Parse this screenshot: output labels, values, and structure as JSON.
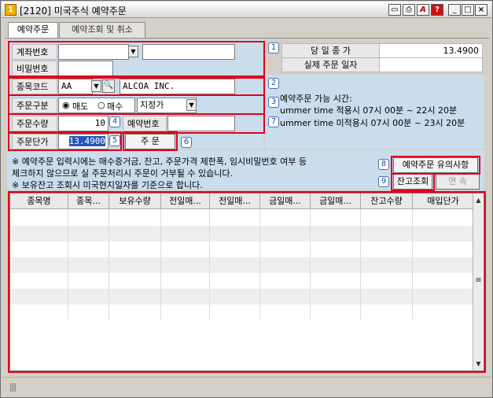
{
  "window": {
    "title": "[2120] 미국주식 예약주문",
    "app_badge": "1",
    "buttons": {
      "help": "?",
      "acrobat": "A"
    }
  },
  "tabs": [
    {
      "label": "예약주문"
    },
    {
      "label": "예약조회 및 취소"
    }
  ],
  "form": {
    "account_label": "계좌번호",
    "account_value": "",
    "account_name_value": "",
    "password_label": "비밀번호",
    "password_value": "",
    "stock_code_label": "종목코드",
    "stock_code_value": "AA",
    "stock_name_value": "ALCOA  INC.",
    "order_type_label": "주문구분",
    "sell_label": "매도",
    "buy_label": "매수",
    "price_type_value": "지정가",
    "quantity_label": "주문수량",
    "quantity_value": "10",
    "reserve_no_label": "예약번호",
    "reserve_no_value": "",
    "price_label": "주문단가",
    "price_value": "13.4900",
    "order_button": "주  문"
  },
  "info": {
    "prev_close_label": "당 일  종 가",
    "prev_close_value": "13.4900",
    "order_date_label": "실제 주문 일자",
    "order_date_value": "",
    "hours_title": "예약주문 가능 시간:",
    "summer_on": "ummer time 적용시   07시 00분 ~ 22시 20분",
    "summer_off": "ummer time 미적용시  07시 00분 ~ 23시 20분"
  },
  "notice": {
    "line1": "※ 예약주문 입력시에는 매수증거금, 잔고, 주문가격 제한폭, 임시비밀번호 여부 등",
    "line2": "   체크하지 않으므로 실 주문처리시 주문이 거부될 수 있습니다.",
    "line3": "※ 보유잔고 조회시 미국현지일자를 기준으로 합니다.",
    "caution_button": "예약주문 유의사항",
    "balance_button": "잔고조회",
    "continue_button": "연  속"
  },
  "badges": [
    "1",
    "2",
    "3",
    "4",
    "5",
    "6",
    "7",
    "8",
    "9"
  ],
  "grid": {
    "columns": [
      "종목명",
      "종목...",
      "보유수량",
      "전일매...",
      "전일매...",
      "금일매...",
      "금일매...",
      "잔고수량",
      "매입단가"
    ],
    "rows": []
  },
  "colors": {
    "highlight_red": "#e0001a",
    "panel_blue": "#c9dded",
    "badge_blue": "#2050a0"
  }
}
